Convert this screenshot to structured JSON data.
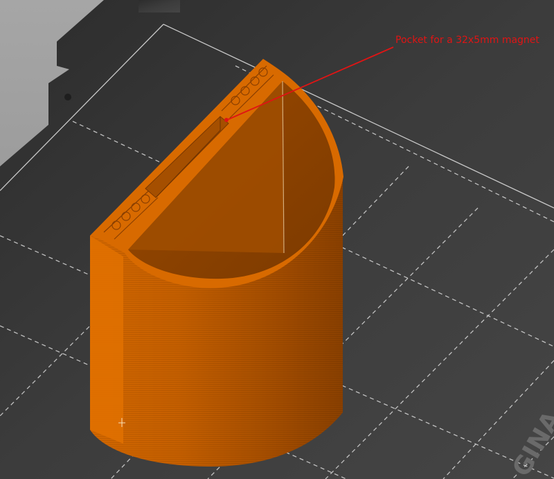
{
  "annotation": {
    "text": "Pocket for a 32x5mm magnet",
    "color": "#e01414"
  },
  "print_bed": {
    "logo_text": "GINA",
    "surface_color": "#3a3a3a",
    "grid_color": "#d8d8d8"
  },
  "model": {
    "name": "half-cylinder cup with magnet pocket",
    "color": "#d86a00"
  }
}
